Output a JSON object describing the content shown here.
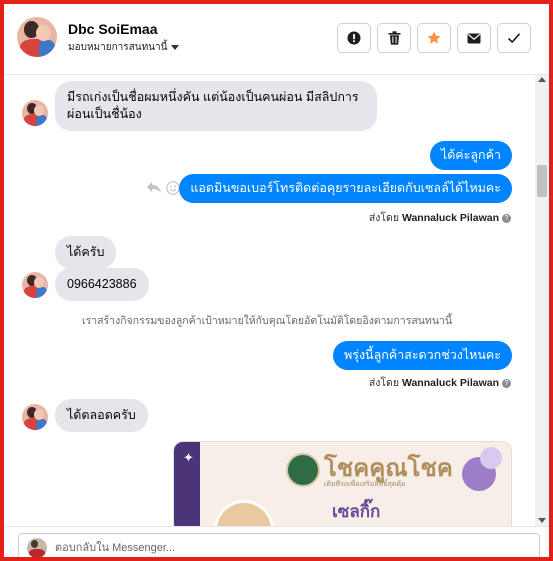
{
  "header": {
    "name": "Dbc SoiEmaa",
    "assign_label": "มอบหมายการสนทนานี้",
    "actions": [
      {
        "icon": "alert-icon",
        "name": "mark-spam-button"
      },
      {
        "icon": "trash-icon",
        "name": "delete-button"
      },
      {
        "icon": "star-icon",
        "name": "star-button"
      },
      {
        "icon": "envelope-icon",
        "name": "mark-unread-button"
      },
      {
        "icon": "checkmark-icon",
        "name": "done-button"
      }
    ]
  },
  "messages": {
    "incoming_1": "มีรถเก่งเป็นชื่อผมหนึ่งคัน แต่น้องเป็นคนผ่อน มีสลิปการผ่อนเป็นชื่น้อง",
    "outgoing_1": "ได้ค่ะลูกค้า",
    "outgoing_2": "แอดมินขอเบอร์โทรติดต่อคุยรายละเอียดกับเซลล์ได้ไหมคะ",
    "sent_by_prefix_1": "ส่งโดย",
    "sent_by_name_1": "Wannaluck Pilawan",
    "incoming_2": "ได้ครับ",
    "incoming_3": "0966423886",
    "system_note": "เราสร้างกิจกรรมของลูกค้าเป้าหมายให้กับคุณโดยอัตโนมัติโดยอิงตามการสนทนานี้",
    "outgoing_3": "พรุ่งนี้ลูกค้าสะดวกช่วงไหนคะ",
    "sent_by_prefix_2": "ส่งโดย",
    "sent_by_name_2": "Wannaluck Pilawan",
    "incoming_4": "ได้ตลอดครับ"
  },
  "image_card": {
    "title": "โชคคูณโชค",
    "tagline": "เติมทีรถเพื่อเสริมสิทธิ์สุดคุ้ม",
    "subtitle": "เซลกิ๊ก"
  },
  "composer": {
    "placeholder": "ตอบกลับใน Messenger..."
  },
  "colors": {
    "outgoing_bubble": "#0084ff",
    "incoming_bubble": "#e4e6eb",
    "star_accent": "#f7923a",
    "frame_border": "#e5201b"
  }
}
